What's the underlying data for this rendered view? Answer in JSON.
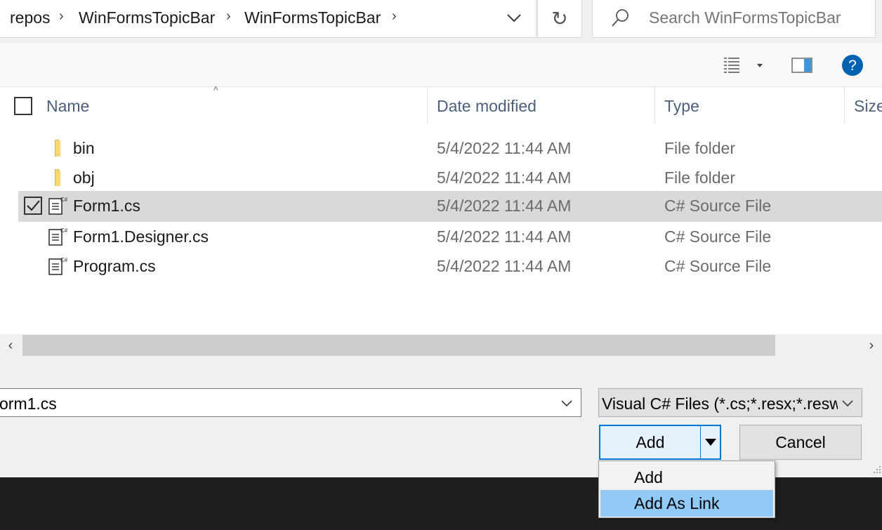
{
  "breadcrumb": {
    "items": [
      "repos",
      "WinFormsTopicBar",
      "WinFormsTopicBar"
    ]
  },
  "search": {
    "placeholder": "Search WinFormsTopicBar"
  },
  "columns": {
    "name": "Name",
    "date": "Date modified",
    "type": "Type",
    "size": "Size"
  },
  "files": [
    {
      "name": "bin",
      "date": "5/4/2022 11:44 AM",
      "type": "File folder",
      "icon": "folder-icon",
      "selected": false
    },
    {
      "name": "obj",
      "date": "5/4/2022 11:44 AM",
      "type": "File folder",
      "icon": "folder-icon",
      "selected": false
    },
    {
      "name": "Form1.cs",
      "date": "5/4/2022 11:44 AM",
      "type": "C# Source File",
      "icon": "csharp-file-icon",
      "selected": true
    },
    {
      "name": "Form1.Designer.cs",
      "date": "5/4/2022 11:44 AM",
      "type": "C# Source File",
      "icon": "csharp-file-icon",
      "selected": false
    },
    {
      "name": "Program.cs",
      "date": "5/4/2022 11:44 AM",
      "type": "C# Source File",
      "icon": "csharp-file-icon",
      "selected": false
    }
  ],
  "filename": {
    "value": "orm1.cs"
  },
  "filetype": {
    "selected": "Visual C# Files (*.cs;*.resx;*.resw;"
  },
  "buttons": {
    "add": "Add",
    "cancel": "Cancel"
  },
  "add_menu": {
    "items": [
      "Add",
      "Add As Link"
    ],
    "highlighted_index": 1
  },
  "colors": {
    "accent": "#0078d7",
    "selection": "#d9d9d9",
    "menu_highlight": "#91c9f7",
    "help": "#0063b1"
  }
}
